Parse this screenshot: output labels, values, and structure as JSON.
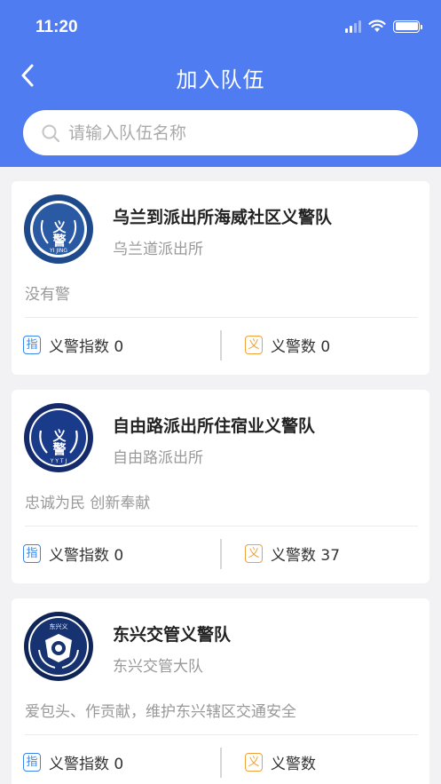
{
  "status_bar": {
    "time": "11:20"
  },
  "nav": {
    "title": "加入队伍"
  },
  "search": {
    "placeholder": "请输入队伍名称"
  },
  "teams": [
    {
      "name": "乌兰到派出所海威社区义警队",
      "station": "乌兰道派出所",
      "slogan": "没有警",
      "index_label": "义警指数 0",
      "count_label": "义警数 0",
      "badge": {
        "text": "义警",
        "sub": "YI JING",
        "style": "light"
      }
    },
    {
      "name": "自由路派出所住宿业义警队",
      "station": "自由路派出所",
      "slogan": "忠诚为民 创新奉献",
      "index_label": "义警指数 0",
      "count_label": "义警数 37",
      "badge": {
        "text": "义警",
        "sub": "Y Y T J",
        "style": "dark"
      }
    },
    {
      "name": "东兴交管义警队",
      "station": "东兴交管大队",
      "slogan": "爱包头、作贡献，维护东兴辖区交通安全",
      "index_label": "义警指数 0",
      "count_label": "义警数",
      "badge": {
        "text": "东兴义",
        "style": "police"
      }
    }
  ],
  "stat_icons": {
    "index": "指",
    "count": "义"
  },
  "colors": {
    "header": "#4f7cf0",
    "index_icon": "#3b86e8",
    "count_icon": "#f0a13a"
  }
}
